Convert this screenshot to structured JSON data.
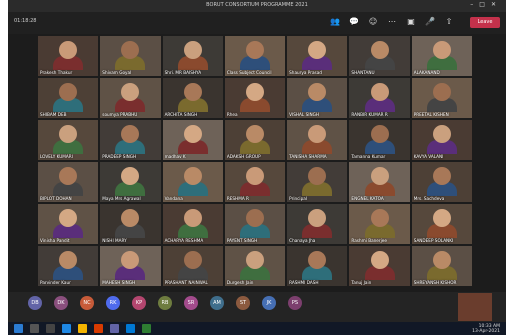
{
  "window": {
    "title": "BORUT CONSORTIUM PROGRAMME 2021"
  },
  "meeting": {
    "timer": "01:18:28",
    "leave_label": "Leave"
  },
  "tiles": [
    {
      "name": "Prakesh Thakur"
    },
    {
      "name": "Shivam Goyal"
    },
    {
      "name": "Shri. MR BAISHYA"
    },
    {
      "name": "Class Subject Council"
    },
    {
      "name": "Shaurya Prasad"
    },
    {
      "name": "SHANTANU"
    },
    {
      "name": "ALAKANAND"
    },
    {
      "name": "SHIBAM DEB"
    },
    {
      "name": "soumya PRABHU"
    },
    {
      "name": "ARCHITA SINGH"
    },
    {
      "name": "Rhea"
    },
    {
      "name": "VISHAL SINGH"
    },
    {
      "name": "RANBIR KUMAR R"
    },
    {
      "name": "PREETAL KISHEN"
    },
    {
      "name": "LOVELY KUMARI"
    },
    {
      "name": "PRADEEP SINGH"
    },
    {
      "name": "madhav K"
    },
    {
      "name": "ADAKSH GROUP"
    },
    {
      "name": "TANISHA SHARMA"
    },
    {
      "name": "Tamanna Kumar"
    },
    {
      "name": "KAVYA VALANI"
    },
    {
      "name": "BIPLOT DOHAN"
    },
    {
      "name": "Maya Mrs Agrawal"
    },
    {
      "name": "Vandana"
    },
    {
      "name": "RESHMA R"
    },
    {
      "name": "Principal"
    },
    {
      "name": "ENGNEL KATOA"
    },
    {
      "name": "Mrs. Sachdeva"
    },
    {
      "name": "Vinisha Pandit"
    },
    {
      "name": "NISHI MARY"
    },
    {
      "name": "ACHARYA RESHMA"
    },
    {
      "name": "PAYENT SINGH"
    },
    {
      "name": "Chanaya Jha"
    },
    {
      "name": "Rashmi Banerjee"
    },
    {
      "name": "SANDEEP SOLANKI"
    },
    {
      "name": "Parvinder Kaur"
    },
    {
      "name": "MAHESH SINGH"
    },
    {
      "name": "PRASHANT NAINWAL"
    },
    {
      "name": "Durgesh Jain"
    },
    {
      "name": "RASHMI DASH"
    },
    {
      "name": "Tanuj Jain"
    },
    {
      "name": "SHREYANSH KISHOR"
    }
  ],
  "dock": {
    "avatars": [
      {
        "initials": "DB",
        "color": "#6264a7"
      },
      {
        "initials": "DK",
        "color": "#8a4f7d"
      },
      {
        "initials": "NC",
        "color": "#c75b39"
      },
      {
        "initials": "RK",
        "color": "#4f6bed"
      },
      {
        "initials": "KP",
        "color": "#b4466f"
      },
      {
        "initials": "RB",
        "color": "#6e7c3f"
      },
      {
        "initials": "SR",
        "color": "#a34b8c"
      },
      {
        "initials": "AM",
        "color": "#3f6e8c"
      },
      {
        "initials": "ST",
        "color": "#8c5a3f"
      },
      {
        "initials": "JK",
        "color": "#466fb4"
      },
      {
        "initials": "PS",
        "color": "#7c3f6e"
      }
    ]
  },
  "taskbar": {
    "time": "10:33 AM",
    "date": "13-Apr-2021"
  }
}
